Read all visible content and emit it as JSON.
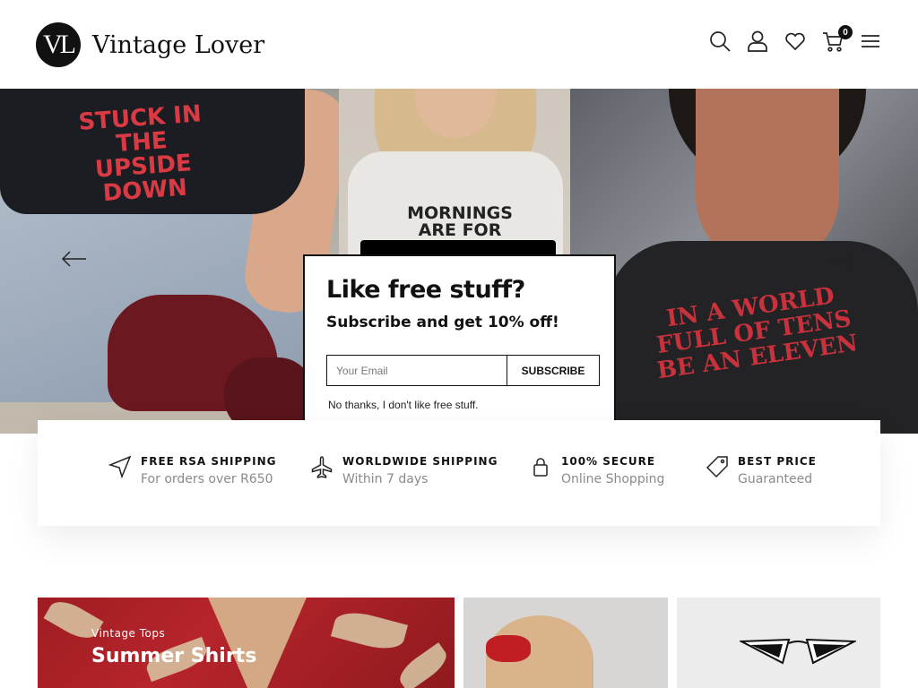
{
  "brand": {
    "logo_mark": "VL",
    "name": "Vintage Lover"
  },
  "header": {
    "icons": [
      "search-icon",
      "user-icon",
      "heart-icon",
      "cart-icon",
      "menu-icon"
    ],
    "cart_count": "0"
  },
  "hero": {
    "panel1_text": "STUCK IN THE UPSIDE DOWN",
    "panel2_text": "MORNINGS ARE FOR COFFEE",
    "panel3_text": "IN A WORLD FULL OF TENS BE AN ELEVEN"
  },
  "popup": {
    "title": "Like free stuff?",
    "subtitle": "Subscribe and get 10% off!",
    "email_placeholder": "Your Email",
    "subscribe_label": "SUBSCRIBE",
    "decline_label": "No thanks, I don't like free stuff."
  },
  "features": [
    {
      "icon": "navigation-arrow-icon",
      "title": "FREE RSA SHIPPING",
      "subtitle": "For orders over R650"
    },
    {
      "icon": "airplane-icon",
      "title": "WORLDWIDE SHIPPING",
      "subtitle": "Within 7 days"
    },
    {
      "icon": "lock-icon",
      "title": "100% SECURE",
      "subtitle": "Online Shopping"
    },
    {
      "icon": "tag-icon",
      "title": "BEST PRICE",
      "subtitle": "Guaranteed"
    }
  ],
  "collections": [
    {
      "kicker": "Vintage Tops",
      "title": "Summer Shirts"
    }
  ],
  "colors": {
    "accent": "#111111",
    "muted_text": "#8a8a8a",
    "shirt_red": "#d93a43"
  }
}
